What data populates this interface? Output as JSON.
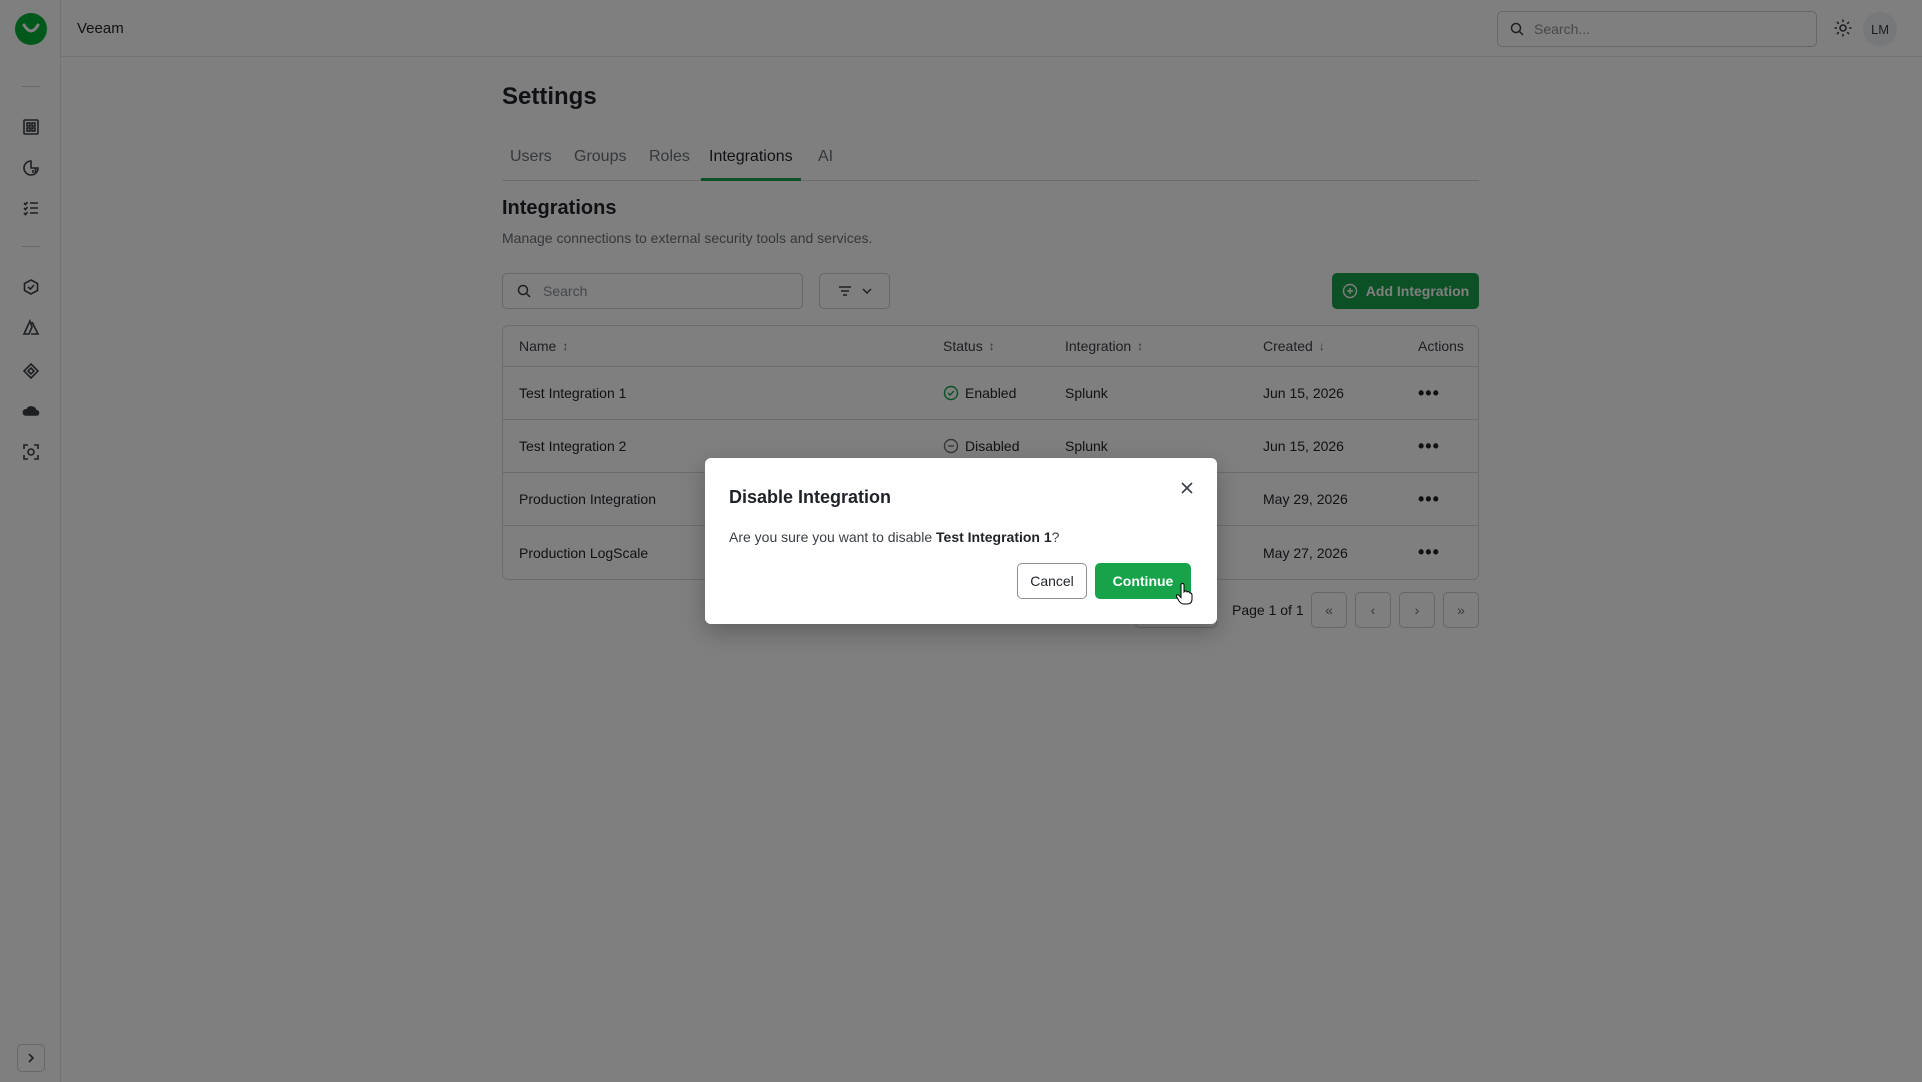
{
  "app": {
    "brand": "Veeam",
    "user_initials": "LM"
  },
  "topbar": {
    "search_placeholder": "Search..."
  },
  "settings": {
    "title": "Settings",
    "tabs": [
      {
        "label": "Users"
      },
      {
        "label": "Groups"
      },
      {
        "label": "Roles"
      },
      {
        "label": "Integrations",
        "active": true
      },
      {
        "label": "AI"
      }
    ]
  },
  "integrations": {
    "title": "Integrations",
    "description": "Manage connections to external security tools and services.",
    "search_placeholder": "Search",
    "add_button": "Add Integration",
    "columns": {
      "name": "Name",
      "status": "Status",
      "integration": "Integration",
      "created": "Created",
      "actions": "Actions"
    },
    "rows": [
      {
        "name": "Test Integration 1",
        "status": "Enabled",
        "integration": "Splunk",
        "created": "Jun 15, 2026"
      },
      {
        "name": "Test Integration 2",
        "status": "Disabled",
        "integration": "Splunk",
        "created": "Jun 15, 2026"
      },
      {
        "name": "Production Integration",
        "status": "",
        "integration": "",
        "created": "May 29, 2026"
      },
      {
        "name": "Production LogScale",
        "status": "",
        "integration": "",
        "created": "May 27, 2026"
      }
    ],
    "pagination": {
      "label": "Page 1 of 1"
    }
  },
  "dialog": {
    "title": "Disable Integration",
    "message_prefix": "Are you sure you want to disable ",
    "target": "Test Integration 1",
    "message_suffix": "?",
    "cancel": "Cancel",
    "continue": "Continue"
  },
  "colors": {
    "accent": "#17a34a",
    "brand_green": "#00b336",
    "enabled": "#17a34a"
  },
  "icons": {
    "rail": [
      "dashboard-icon",
      "analytics-icon",
      "checklist-icon",
      "shield-hex-icon",
      "azure-icon",
      "diamond-icon",
      "cloud-icon",
      "scan-icon"
    ]
  }
}
